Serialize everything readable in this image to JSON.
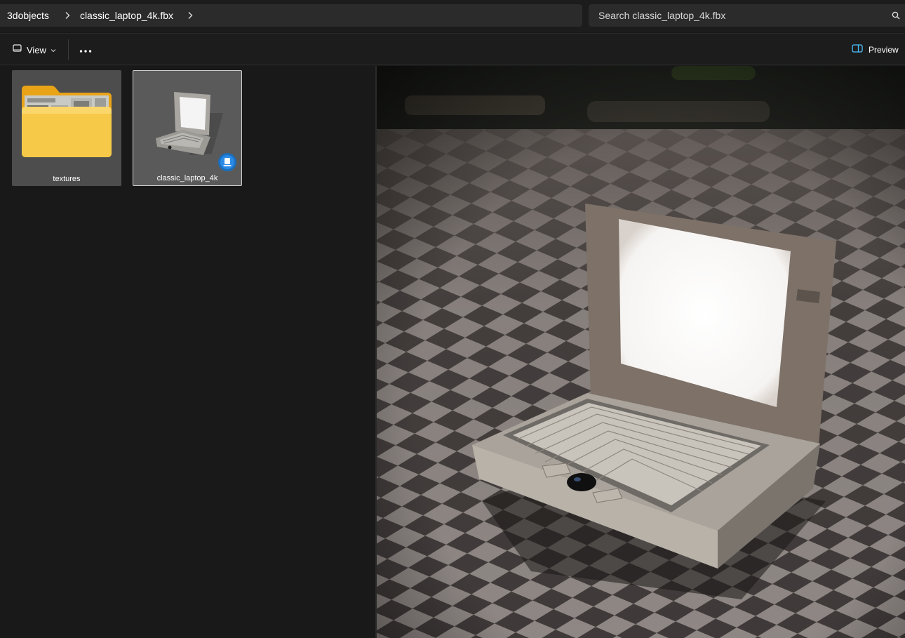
{
  "breadcrumb": {
    "items": [
      "3dobjects",
      "classic_laptop_4k.fbx"
    ]
  },
  "search": {
    "placeholder": "Search classic_laptop_4k.fbx"
  },
  "toolbar": {
    "view_label": "View",
    "preview_label": "Preview"
  },
  "files": [
    {
      "name": "textures",
      "type": "folder"
    },
    {
      "name": "classic_laptop_4k",
      "type": "fbx-model",
      "selected": true
    }
  ],
  "colors": {
    "accent": "#0078d4",
    "folder": "#f5c342",
    "background": "#191919"
  }
}
